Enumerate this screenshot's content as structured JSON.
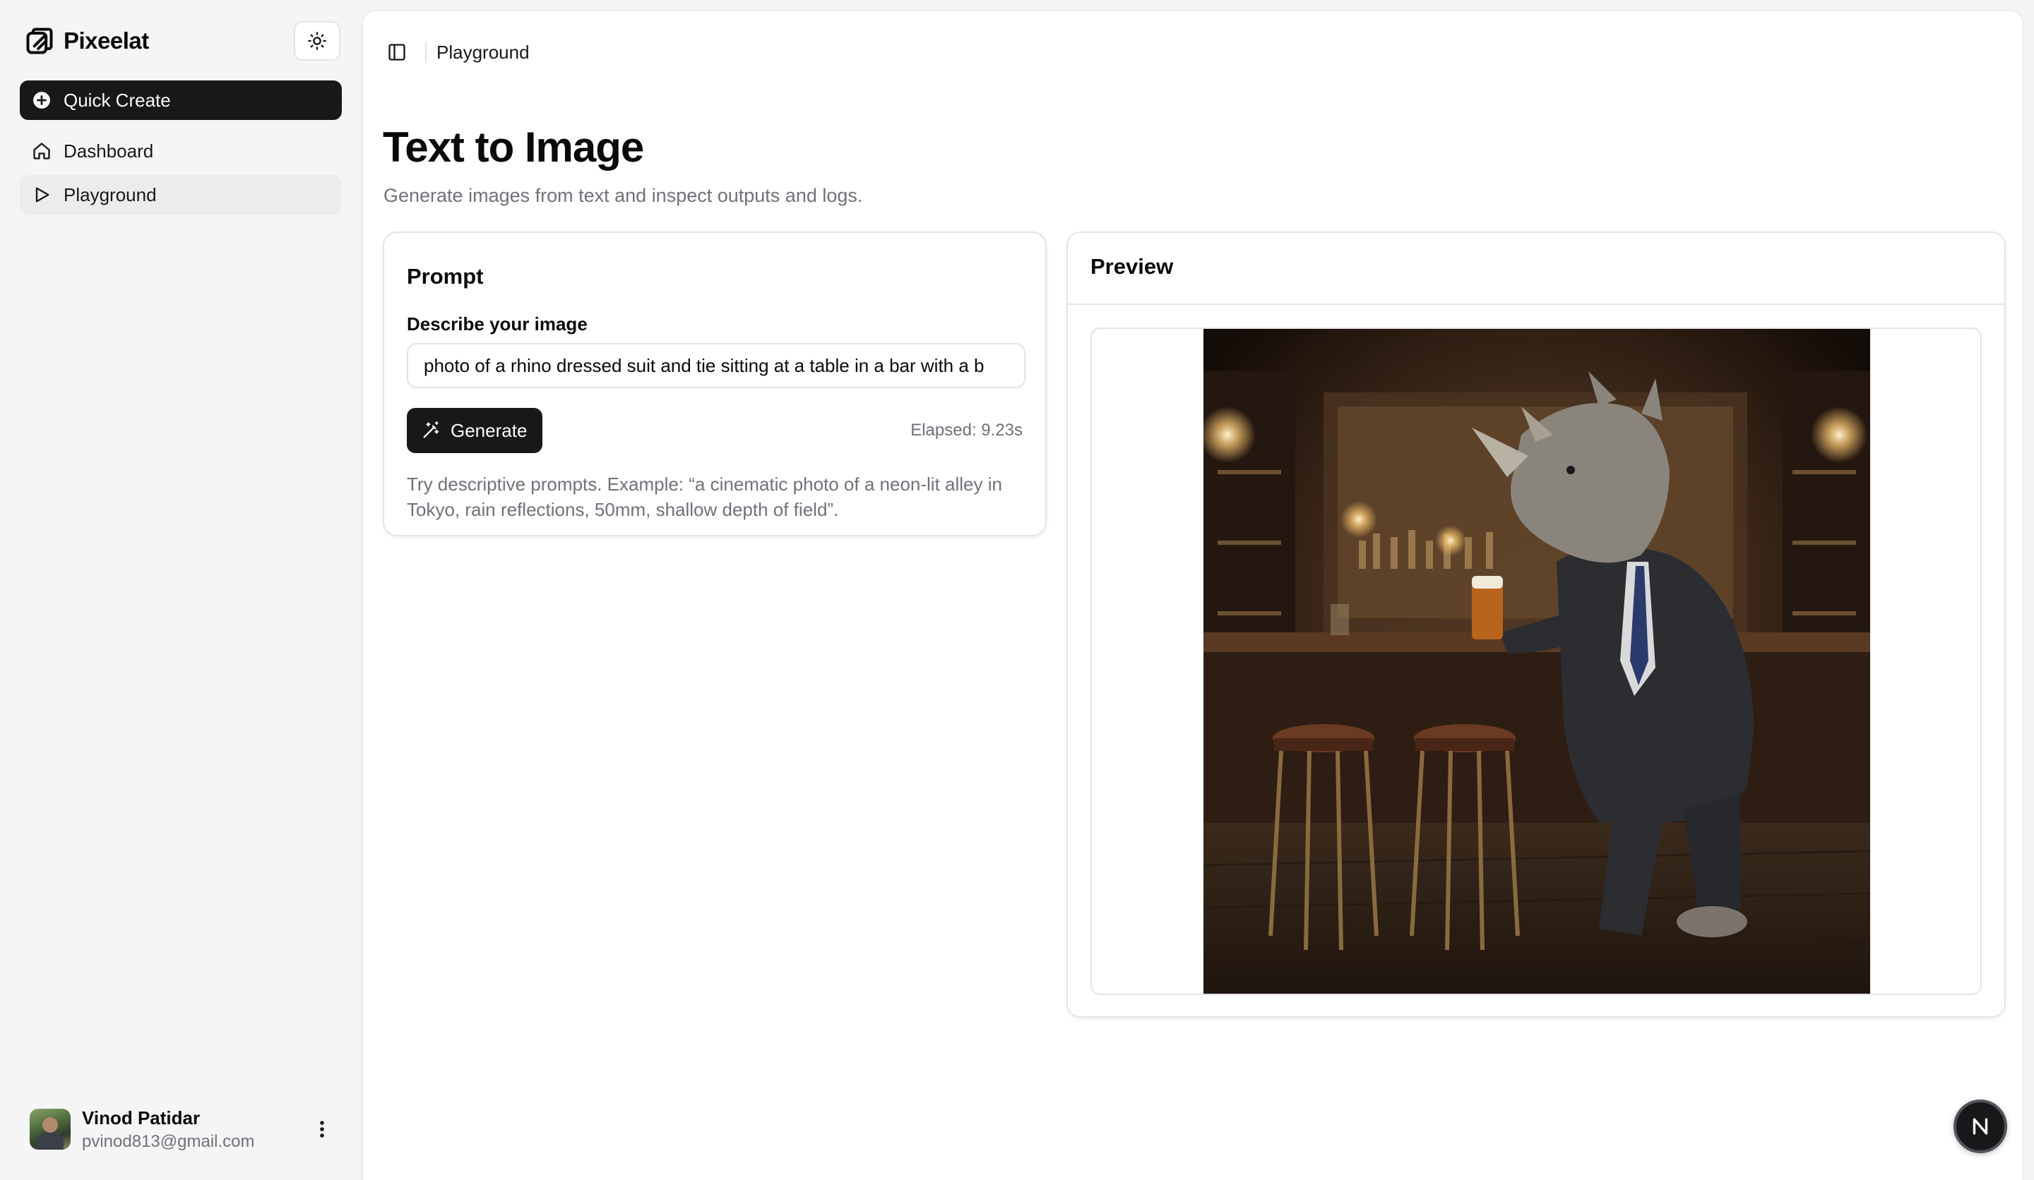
{
  "brand": {
    "name": "Pixeelat"
  },
  "sidebar": {
    "items": [
      {
        "label": "Quick Create",
        "icon": "plus-circle-icon"
      },
      {
        "label": "Dashboard",
        "icon": "home-icon"
      },
      {
        "label": "Playground",
        "icon": "play-icon"
      }
    ]
  },
  "user": {
    "name": "Vinod Patidar",
    "email": "pvinod813@gmail.com"
  },
  "topbar": {
    "breadcrumb": "Playground"
  },
  "page": {
    "title": "Text to Image",
    "subtitle": "Generate images from text and inspect outputs and logs."
  },
  "prompt_card": {
    "title": "Prompt",
    "field_label": "Describe your image",
    "input_value": "photo of a rhino dressed suit and tie sitting at a table in a bar with a b",
    "generate_label": "Generate",
    "elapsed": "Elapsed: 9.23s",
    "hint": "Try descriptive prompts. Example: “a cinematic photo of a neon-lit alley in Tokyo, rain reflections, 50mm, shallow depth of field”."
  },
  "preview_card": {
    "title": "Preview"
  },
  "colors": {
    "primary": "#18181b",
    "muted": "#71717a",
    "border": "#e4e4e7",
    "background": "#f5f5f6"
  },
  "fab": {
    "label": "N"
  }
}
